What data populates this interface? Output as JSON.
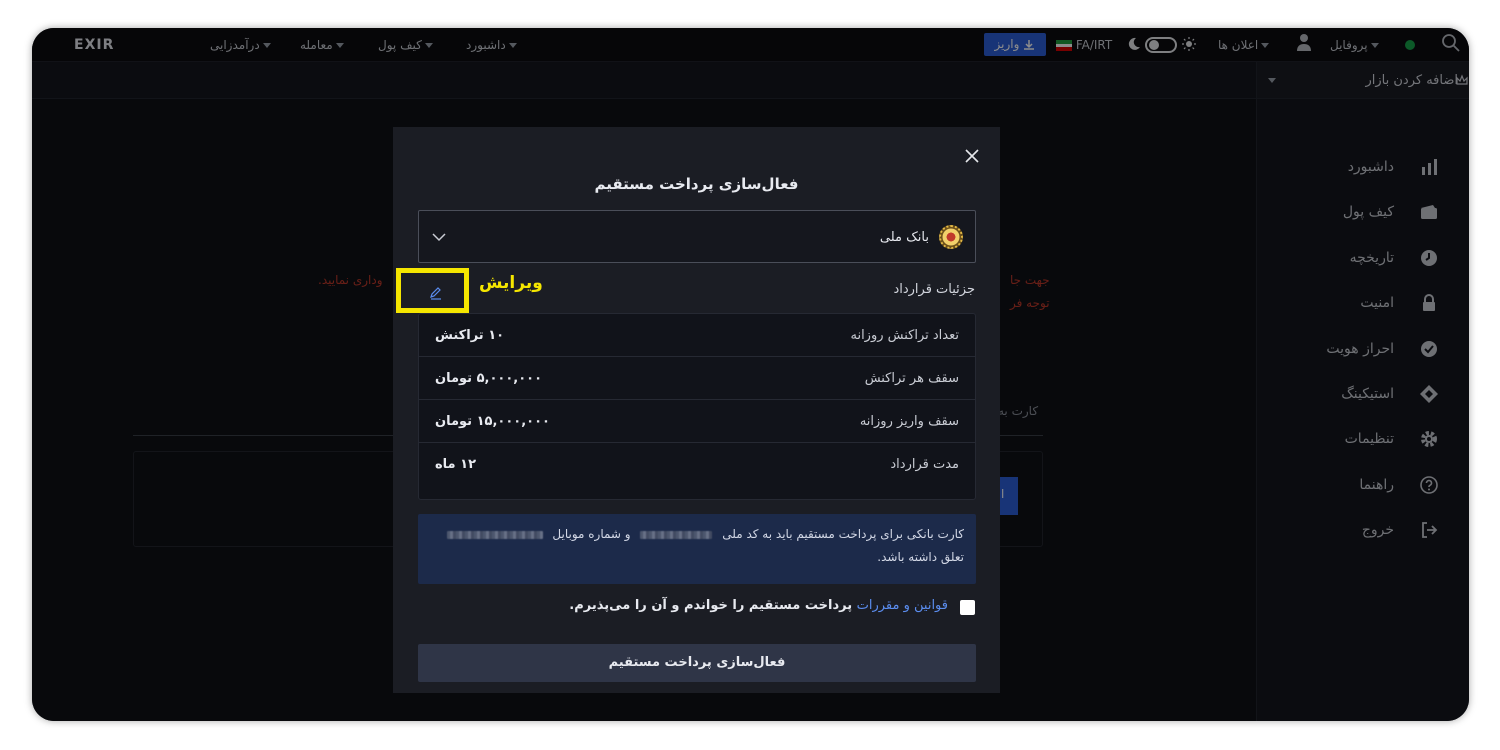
{
  "app": {
    "logo": "EXIR"
  },
  "topbar": {
    "menu": [
      {
        "label": "درآمدزایی"
      },
      {
        "label": "معامله"
      },
      {
        "label": "کیف پول"
      },
      {
        "label": "داشبورد"
      }
    ],
    "deposit_label": "واریز",
    "currency": "FA/IRT",
    "notifications": "اعلان ها",
    "profile": "پروفایل"
  },
  "sidebar": {
    "market_label": "اضافه کردن بازار",
    "items": [
      {
        "label": "داشبورد",
        "icon": "bar-chart-icon"
      },
      {
        "label": "کیف پول",
        "icon": "wallet-icon"
      },
      {
        "label": "تاریخچه",
        "icon": "clock-icon"
      },
      {
        "label": "امنیت",
        "icon": "lock-icon"
      },
      {
        "label": "احراز هویت",
        "icon": "check-circle-icon"
      },
      {
        "label": "استیکینگ",
        "icon": "staking-icon"
      },
      {
        "label": "تنظیمات",
        "icon": "gear-icon"
      },
      {
        "label": "راهنما",
        "icon": "help-icon"
      },
      {
        "label": "خروج",
        "icon": "logout-icon"
      }
    ]
  },
  "background": {
    "red_line_1a": "جهت جا",
    "red_line_1b": "وداری نمایید.",
    "red_line_2": "توجه فر",
    "card_label": "کارت به",
    "blue_stub": "ا"
  },
  "modal": {
    "title": "فعال‌سازی پرداخت مستقیم",
    "bank_name": "بانک ملی",
    "edit_label": "ویرایش",
    "details_label": "جزئیات قرارداد",
    "rows": [
      {
        "key": "تعداد تراکنش روزانه",
        "value": "۱۰ تراکنش"
      },
      {
        "key": "سقف هر تراکنش",
        "value": "۵,۰۰۰,۰۰۰ تومان"
      },
      {
        "key": "سقف واریز روزانه",
        "value": "۱۵,۰۰۰,۰۰۰ تومان"
      },
      {
        "key": "مدت قرارداد",
        "value": "۱۲ ماه"
      }
    ],
    "info_part1": "کارت بانکی برای پرداخت مستقیم باید به کد ملی",
    "info_part2": "و شماره موبایل",
    "info_line2": "تعلق داشته باشد.",
    "terms_link": "قوانین و مقررات",
    "terms_text": "پرداخت مستقیم را خواندم و آن را می‌پذیرم.",
    "submit_label": "فعال‌سازی پرداخت مستقیم"
  },
  "colors": {
    "accent": "#2d5fd9",
    "highlight": "#f5e600",
    "link": "#5b8def"
  }
}
